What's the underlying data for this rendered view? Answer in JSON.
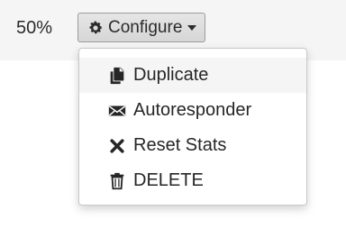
{
  "progress": {
    "value_label": "50%"
  },
  "configure_button": {
    "label": "Configure",
    "icon": "gear-icon"
  },
  "menu": {
    "items": [
      {
        "label": "Duplicate",
        "icon": "copy-icon",
        "highlighted": true
      },
      {
        "label": "Autoresponder",
        "icon": "envelope-icon",
        "highlighted": false
      },
      {
        "label": "Reset Stats",
        "icon": "close-icon",
        "highlighted": false
      },
      {
        "label": "DELETE",
        "icon": "trash-icon",
        "highlighted": false
      }
    ]
  },
  "colors": {
    "text": "#262626",
    "top_band": "#f5f5f5",
    "button_border": "#9c9c9c",
    "menu_highlight": "#f5f5f5"
  }
}
